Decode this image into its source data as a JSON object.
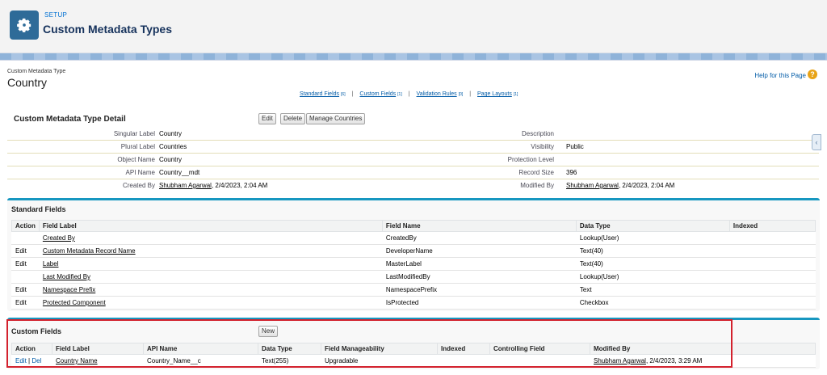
{
  "header": {
    "setup_label": "SETUP",
    "title": "Custom Metadata Types",
    "icon": "gear-icon"
  },
  "page": {
    "object_type_label": "Custom Metadata Type",
    "object_name": "Country",
    "help_link": "Help for this Page",
    "help_icon": "question-icon"
  },
  "related_links": [
    {
      "label": "Standard Fields",
      "count": "[6]"
    },
    {
      "label": "Custom Fields",
      "count": "[1]"
    },
    {
      "label": "Validation Rules",
      "count": "[0]"
    },
    {
      "label": "Page Layouts",
      "count": "[1]"
    }
  ],
  "related_links_separator": "|",
  "detail": {
    "title": "Custom Metadata Type Detail",
    "buttons": {
      "edit": "Edit",
      "delete": "Delete",
      "manage": "Manage Countries"
    },
    "rows": [
      {
        "l_label": "Singular Label",
        "l_value": "Country",
        "r_label": "Description",
        "r_value": ""
      },
      {
        "l_label": "Plural Label",
        "l_value": "Countries",
        "r_label": "Visibility",
        "r_value": "Public"
      },
      {
        "l_label": "Object Name",
        "l_value": "Country",
        "r_label": "Protection Level",
        "r_value": ""
      },
      {
        "l_label": "API Name",
        "l_value": "Country__mdt",
        "r_label": "Record Size",
        "r_value": "396"
      }
    ],
    "created": {
      "label": "Created By",
      "user": "Shubham Agarwal",
      "date": ", 2/4/2023, 2:04 AM"
    },
    "modified": {
      "label": "Modified By",
      "user": "Shubham Agarwal",
      "date": ", 2/4/2023, 2:04 AM"
    }
  },
  "standard_fields": {
    "title": "Standard Fields",
    "columns": [
      "Action",
      "Field Label",
      "Field Name",
      "Data Type",
      "Indexed"
    ],
    "rows": [
      {
        "action": "",
        "label": "Created By",
        "name": "CreatedBy",
        "type": "Lookup(User)",
        "indexed": ""
      },
      {
        "action": "Edit",
        "label": "Custom Metadata Record Name",
        "name": "DeveloperName",
        "type": "Text(40)",
        "indexed": ""
      },
      {
        "action": "Edit",
        "label": "Label",
        "name": "MasterLabel",
        "type": "Text(40)",
        "indexed": ""
      },
      {
        "action": "",
        "label": "Last Modified By",
        "name": "LastModifiedBy",
        "type": "Lookup(User)",
        "indexed": ""
      },
      {
        "action": "Edit",
        "label": "Namespace Prefix",
        "name": "NamespacePrefix",
        "type": "Text",
        "indexed": ""
      },
      {
        "action": "Edit",
        "label": "Protected Component",
        "name": "IsProtected",
        "type": "Checkbox",
        "indexed": ""
      }
    ]
  },
  "custom_fields": {
    "title": "Custom Fields",
    "new_button": "New",
    "columns": [
      "Action",
      "Field Label",
      "API Name",
      "Data Type",
      "Field Manageability",
      "Indexed",
      "Controlling Field",
      "Modified By"
    ],
    "rows": [
      {
        "edit": "Edit",
        "sep": "|",
        "del": "Del",
        "label": "Country Name",
        "api": "Country_Name__c",
        "type": "Text(255)",
        "manage": "Upgradable",
        "indexed": "",
        "controlling": "",
        "mod_user": "Shubham Agarwal",
        "mod_date": ", 2/4/2023, 3:29 AM"
      }
    ]
  },
  "colors": {
    "accent": "#1797c0",
    "link": "#015ba7",
    "highlight": "#d3212d",
    "icon_bg": "#2e6b98"
  }
}
